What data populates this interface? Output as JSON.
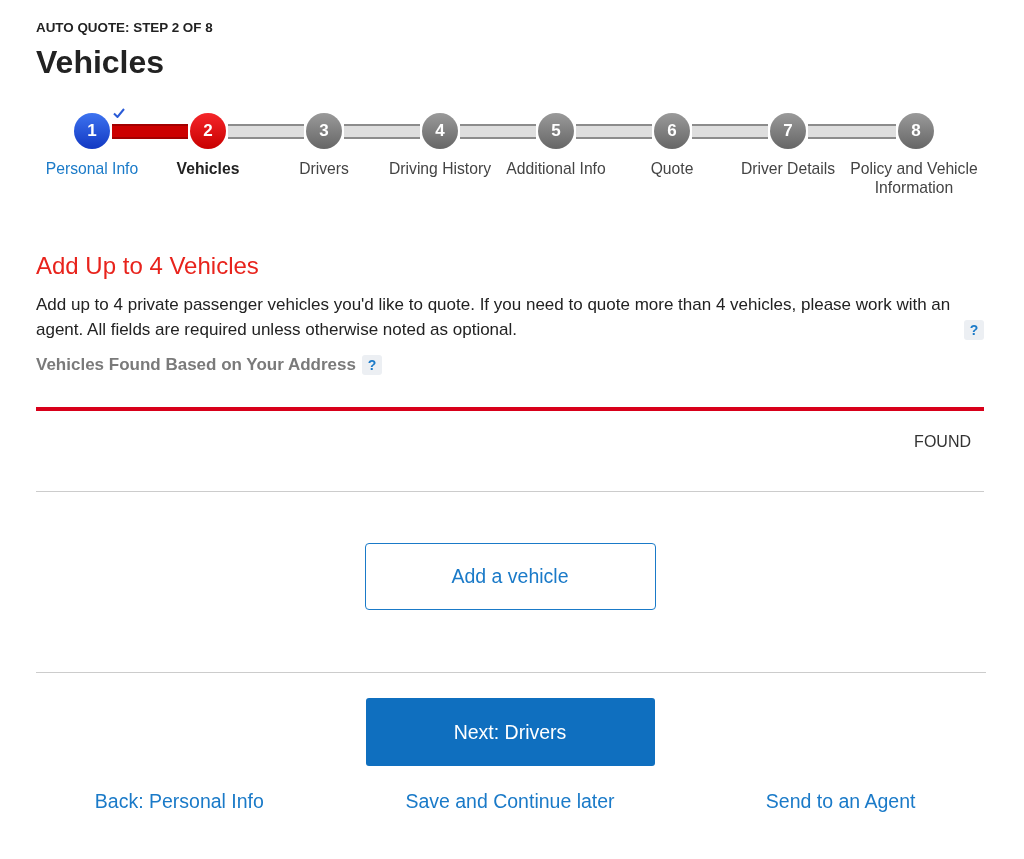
{
  "header": {
    "step_label": "AUTO QUOTE: STEP 2 OF 8",
    "title": "Vehicles"
  },
  "steps": [
    {
      "number": "1",
      "label": "Personal Info",
      "completed": true,
      "selected": false
    },
    {
      "number": "2",
      "label": "Vehicles",
      "completed": false,
      "selected": true
    },
    {
      "number": "3",
      "label": "Drivers",
      "completed": false,
      "selected": false
    },
    {
      "number": "4",
      "label": "Driving History",
      "completed": false,
      "selected": false
    },
    {
      "number": "5",
      "label": "Additional Info",
      "completed": false,
      "selected": false
    },
    {
      "number": "6",
      "label": "Quote",
      "completed": false,
      "selected": false
    },
    {
      "number": "7",
      "label": "Driver Details",
      "completed": false,
      "selected": false
    },
    {
      "number": "8",
      "label": "Policy and Vehicle Information",
      "completed": false,
      "selected": false
    }
  ],
  "section": {
    "heading": "Add Up to 4 Vehicles",
    "description": "Add up to 4 private passenger vehicles you'd like to quote. If you need to quote more than 4 vehicles, please work with an agent. All fields are required unless otherwise noted as optional.",
    "help": "?"
  },
  "vehicles_found": {
    "label": "Vehicles Found Based on Your Address",
    "help": "?",
    "columns": [
      "FOUND"
    ]
  },
  "add_button": "Add a vehicle",
  "next_button": "Next: Drivers",
  "footer_links": [
    "Back: Personal Info",
    "Save and Continue later",
    "Send to an Agent"
  ]
}
